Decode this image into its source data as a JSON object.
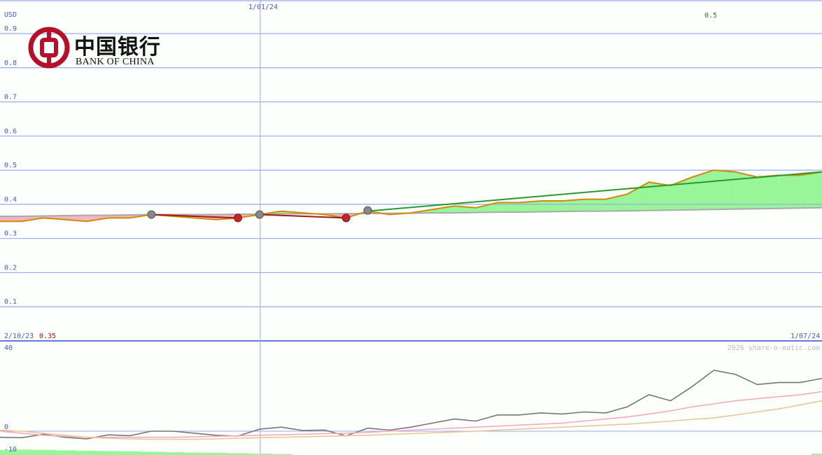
{
  "logo": {
    "name_cn": "中国银行",
    "name_en": "BANK OF CHINA",
    "brand_color": "#b5102a"
  },
  "colors": {
    "price": "#d4890a",
    "trend_up": "#2a9a2a",
    "trend_down": "#a01818",
    "fill_up": "#98f698",
    "fill_down": "#f0b6c0",
    "grid": "#99aaee",
    "axis_text": "#4a5ac8",
    "osc_main": "#777777",
    "osc_signal1": "#f4aac4",
    "osc_signal2": "#e8c898",
    "hist": "#98f698"
  },
  "chart_data": [
    {
      "type": "line",
      "currency": "USD",
      "ylim": [
        0,
        0.9
      ],
      "yticks": [
        "0.1",
        "0.2",
        "0.3",
        "0.4",
        "0.5",
        "0.6",
        "0.7",
        "0.8",
        "0.9"
      ],
      "grid": true,
      "x_dates": {
        "start": "2/10/23",
        "mid": "1/01/24",
        "end": "1/07/24"
      },
      "start_price_label": "0.35",
      "last_price_label": "0.5",
      "price": [
        0.35,
        0.35,
        0.36,
        0.355,
        0.35,
        0.36,
        0.36,
        0.37,
        0.365,
        0.36,
        0.355,
        0.36,
        0.37,
        0.38,
        0.375,
        0.37,
        0.36,
        0.38,
        0.37,
        0.375,
        0.385,
        0.395,
        0.39,
        0.405,
        0.405,
        0.41,
        0.41,
        0.415,
        0.415,
        0.43,
        0.465,
        0.455,
        0.48,
        0.5,
        0.495,
        0.48,
        0.485,
        0.485,
        0.495
      ],
      "baseline": [
        0.365,
        0.365,
        0.366,
        0.367,
        0.368,
        0.368,
        0.369,
        0.37,
        0.37,
        0.37,
        0.37,
        0.371,
        0.371,
        0.372,
        0.372,
        0.372,
        0.373,
        0.373,
        0.374,
        0.374,
        0.375,
        0.375,
        0.376,
        0.377,
        0.377,
        0.378,
        0.379,
        0.38,
        0.38,
        0.381,
        0.382,
        0.383,
        0.384,
        0.385,
        0.386,
        0.387,
        0.388,
        0.389,
        0.39
      ],
      "trend_segments": [
        {
          "direction": "down",
          "from": 7,
          "to": 11,
          "values": [
            0.37,
            0.36
          ]
        },
        {
          "direction": "down",
          "from": 12,
          "to": 16,
          "values": [
            0.37,
            0.36
          ]
        },
        {
          "direction": "up",
          "from": 17,
          "to": 38,
          "values": [
            0.38,
            0.495
          ]
        }
      ],
      "markers": [
        {
          "index": 7,
          "value": 0.37,
          "kind": "neutral"
        },
        {
          "index": 11,
          "value": 0.36,
          "kind": "down"
        },
        {
          "index": 12,
          "value": 0.37,
          "kind": "neutral"
        },
        {
          "index": 16,
          "value": 0.36,
          "kind": "down"
        },
        {
          "index": 17,
          "value": 0.382,
          "kind": "neutral"
        }
      ]
    },
    {
      "type": "line",
      "ylim": [
        -10,
        40
      ],
      "yticks": [
        "40",
        "0",
        "-10"
      ],
      "watermark": "2026 share-o-matic.com",
      "series": [
        {
          "values": [
            -3,
            -3.2,
            -1.5,
            -3,
            -3.8,
            -1.8,
            -2.2,
            0,
            0,
            -1,
            -2,
            -2.4,
            1,
            2,
            0.3,
            0.6,
            -2.3,
            1.5,
            0.5,
            2,
            4,
            6,
            5,
            8,
            8,
            9,
            8.5,
            9.5,
            9,
            12,
            18,
            15,
            22,
            30,
            28,
            23,
            24,
            24,
            26
          ]
        },
        {
          "values": [
            0,
            -1,
            -2,
            -2.5,
            -3,
            -3,
            -3,
            -3,
            -3,
            -2.8,
            -2.5,
            -2.3,
            -2,
            -1.8,
            -1.5,
            -1.2,
            -1,
            -0.6,
            0,
            0.5,
            1,
            1.5,
            2,
            2.5,
            3,
            3.5,
            4,
            5,
            6,
            7,
            8.5,
            10,
            12,
            13.5,
            15,
            16,
            17,
            18,
            19.5
          ]
        },
        {
          "values": [
            0.5,
            0,
            -1,
            -2,
            -3,
            -3.5,
            -3.8,
            -4,
            -4,
            -4,
            -3.8,
            -3.5,
            -3.2,
            -3,
            -2.8,
            -2.5,
            -2.2,
            -2,
            -1.6,
            -1.2,
            -0.8,
            -0.4,
            0,
            0.5,
            1,
            1.5,
            2,
            2.5,
            3,
            3.5,
            4.2,
            5,
            5.8,
            6.5,
            8,
            9.5,
            11,
            13,
            15
          ]
        }
      ],
      "histogram": [
        -4.5,
        -4.8,
        -4.6,
        -4.2,
        -3.8,
        -3.5,
        -3.2,
        -2.8,
        -2.5,
        -2.2,
        -2,
        -1.6,
        -1.2,
        -0.8,
        0,
        0,
        0,
        0,
        0,
        0,
        0,
        0,
        0,
        0,
        0,
        0,
        0,
        0,
        0,
        0,
        0,
        0,
        0,
        0,
        0,
        0,
        0,
        0,
        -1.2
      ]
    }
  ]
}
